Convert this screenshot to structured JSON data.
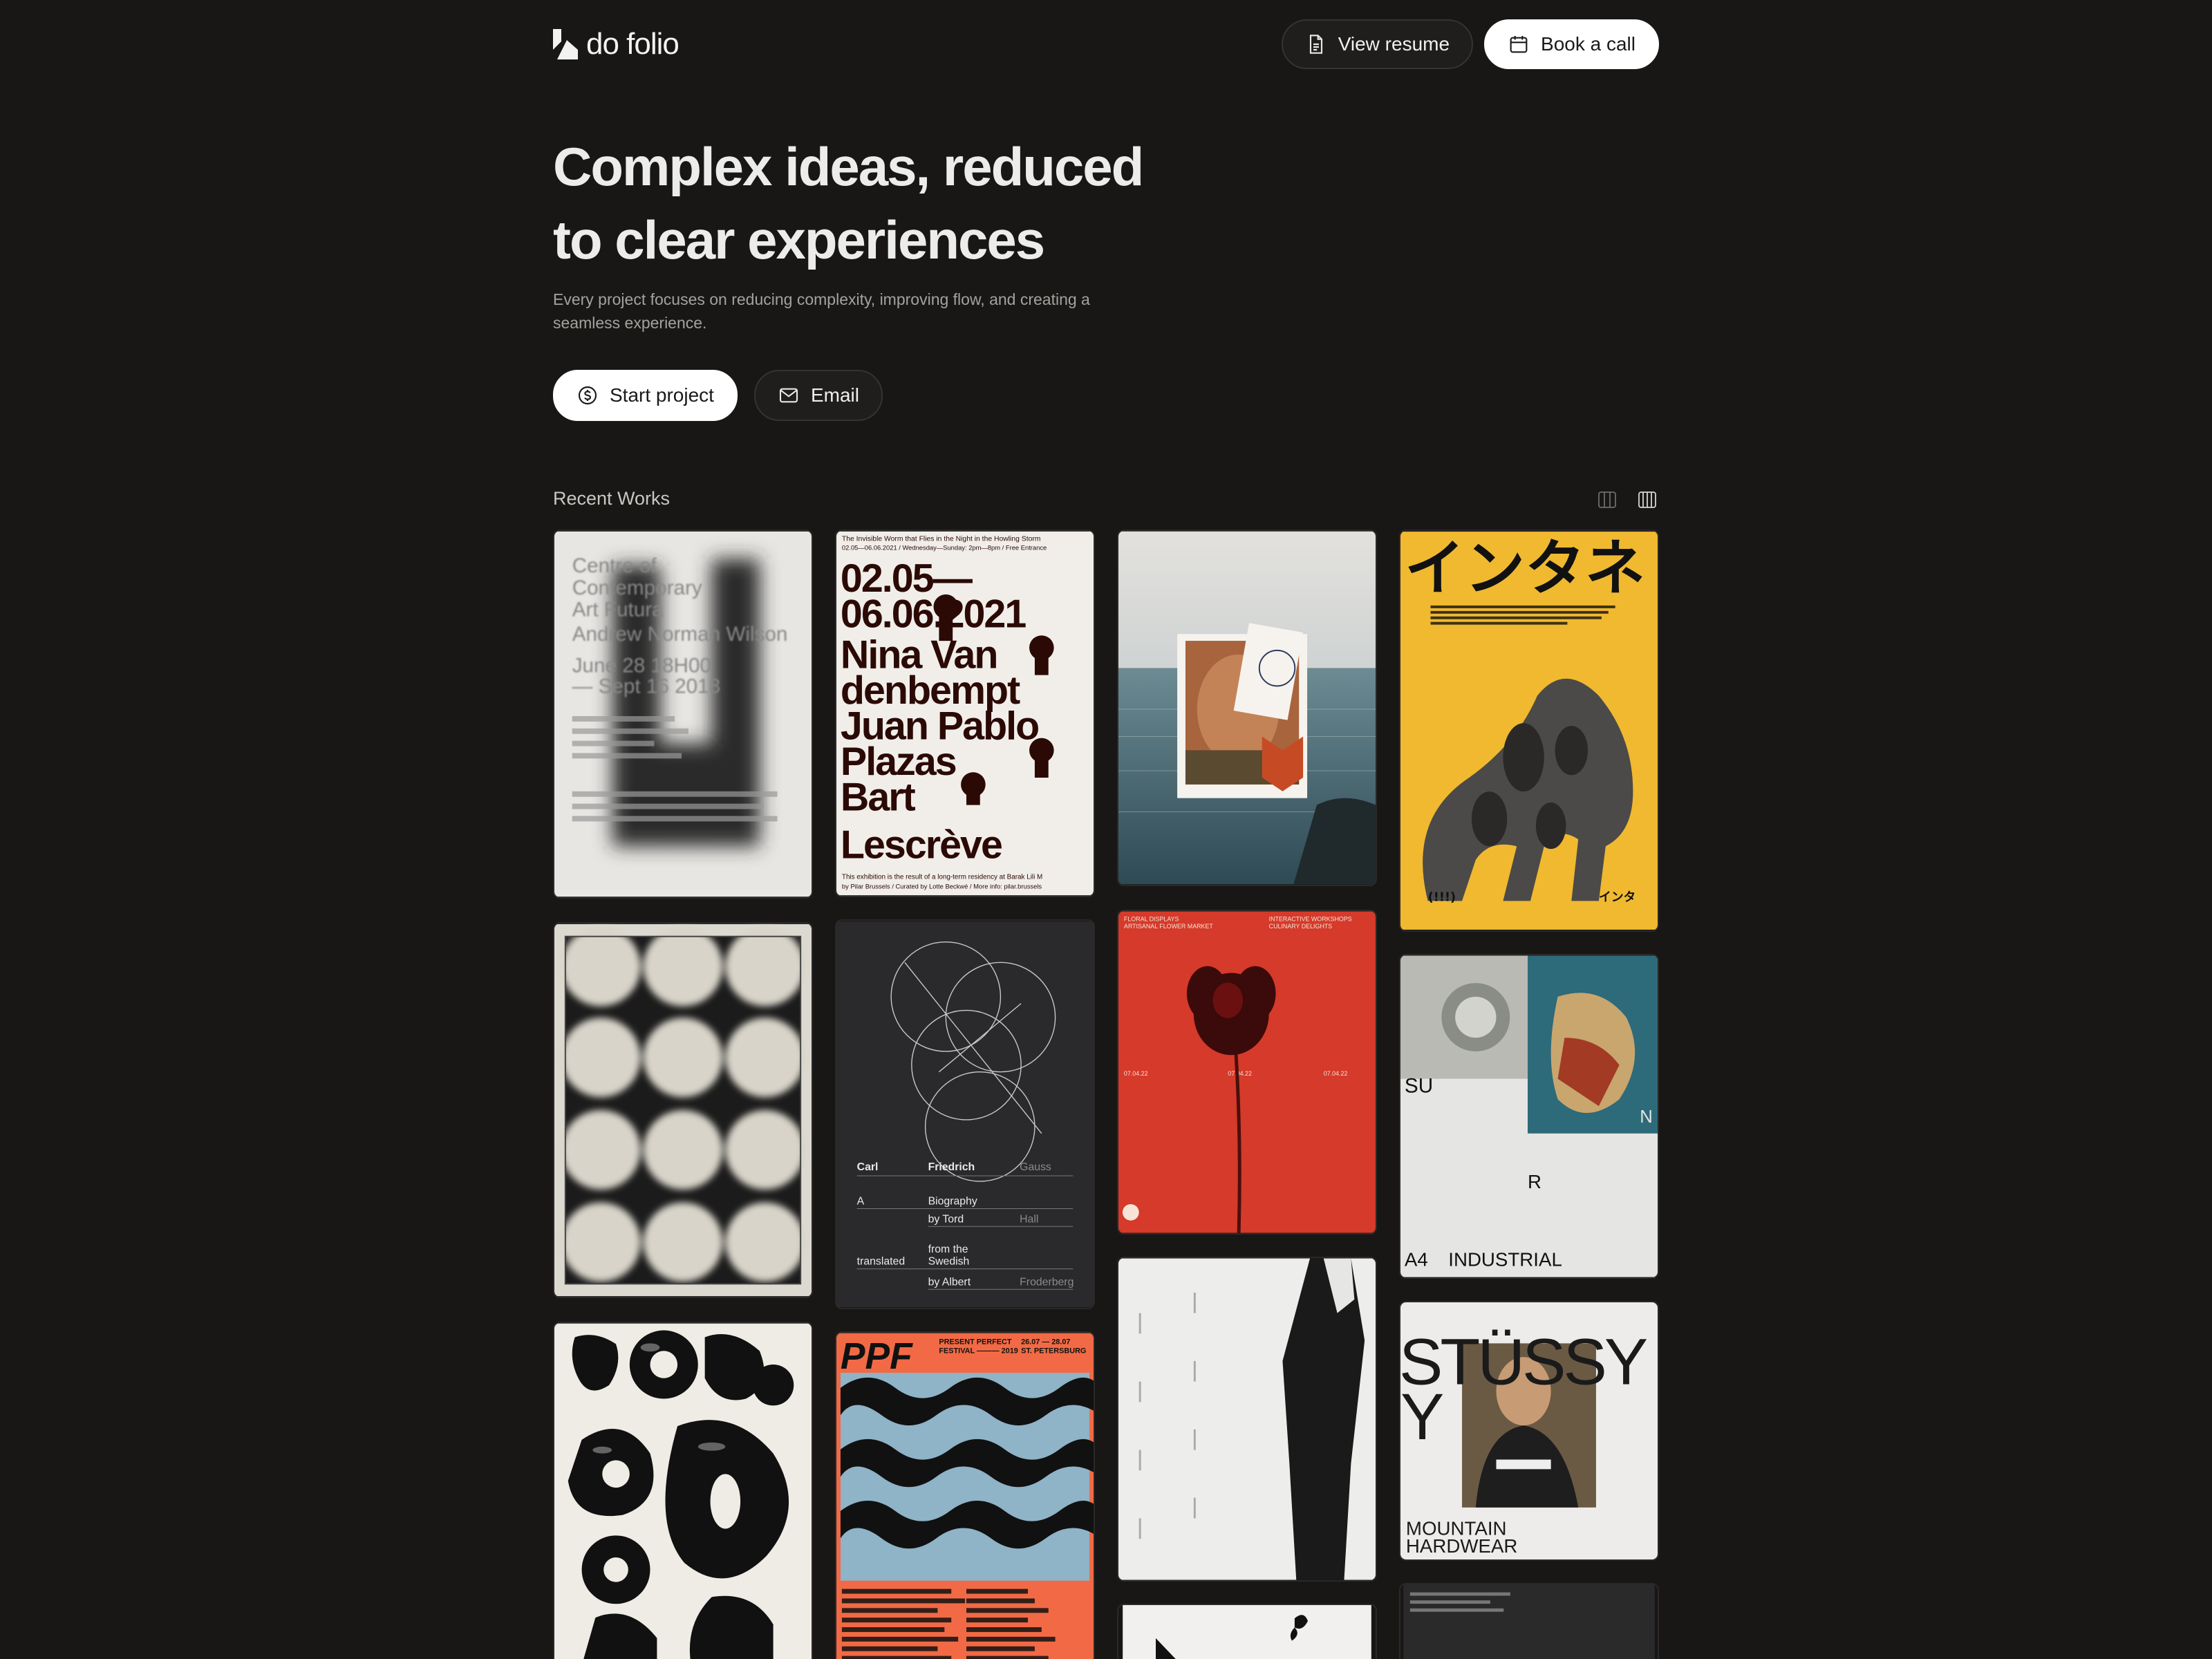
{
  "header": {
    "brand": "do folio",
    "view_resume": "View resume",
    "book_call": "Book a call"
  },
  "hero": {
    "title_line1": "Complex ideas, reduced",
    "title_line2": "to clear experiences",
    "subtitle": "Every project focuses on reducing complexity, improving flow, and creating a seamless experience.",
    "start_project": "Start project",
    "email": "Email"
  },
  "works": {
    "title": "Recent Works",
    "posters": {
      "p1": {
        "l1": "Centre of",
        "l2": "Contemporary",
        "l3": "Art Futura",
        "l4": "Andrew Norman Wilson",
        "l5": "June 28 18H00",
        "l6": "— Sept 16 2018"
      },
      "p2": {
        "top1": "The Invisible Worm that Flies in the Night in the Howling Storm",
        "top2": "02.05—06.06.2021  /  Wednesday—Sunday: 2pm—8pm  /  Free Entrance",
        "d1": "02.05—",
        "d2": "06.06.2021",
        "n1": "Nina Van",
        "n2": "denbempt",
        "n3": "Juan Pablo",
        "n4": "Plazas",
        "n5": "Bart",
        "n6": "Lescrève",
        "b1": "This exhibition is the result of a long-term residency at Barak Lili M",
        "b2": "by Pilar Brussels  /  Curated by Lotte Beckwé  /  More info: pilar.brussels"
      },
      "p4": {
        "big": "インタネ",
        "small1": "(!!!)",
        "small2": "インタ"
      },
      "p6": {
        "r1a": "Carl",
        "r1b": "Friedrich",
        "r1c": "Gauss",
        "r2a": "A",
        "r2b": "Biography",
        "r3b": "by Tord",
        "r3c": "Hall",
        "r4b": "from the",
        "r5a": "translated",
        "r5b": "Swedish",
        "r6b": "by Albert",
        "r6c": "Froderberg"
      },
      "p7": {
        "h1": "FLORAL DISPLAYS",
        "h2": "ARTISANAL FLOWER MARKET",
        "h3": "INTERACTIVE WORKSHOPS",
        "h4": "CULINARY DELIGHTS",
        "d1": "07.04.22",
        "d2": "07.04.22",
        "d3": "07.04.22"
      },
      "p8": {
        "su": "SU",
        "n": "N",
        "r": "R",
        "a4": "A4",
        "industrial": "INDUSTRIAL"
      },
      "p10": {
        "brand": "STÜSSY",
        "y": "Y",
        "mh1": "MOUNTAIN",
        "mh2": "HARDWEAR"
      },
      "p12": {
        "ppf": "PPF",
        "fest1": "PRESENT PERFECT",
        "fest2": "FESTIVAL ——— 2019",
        "d1": "26.07 — 28.07",
        "d2": "ST. PETERSBURG"
      }
    }
  }
}
